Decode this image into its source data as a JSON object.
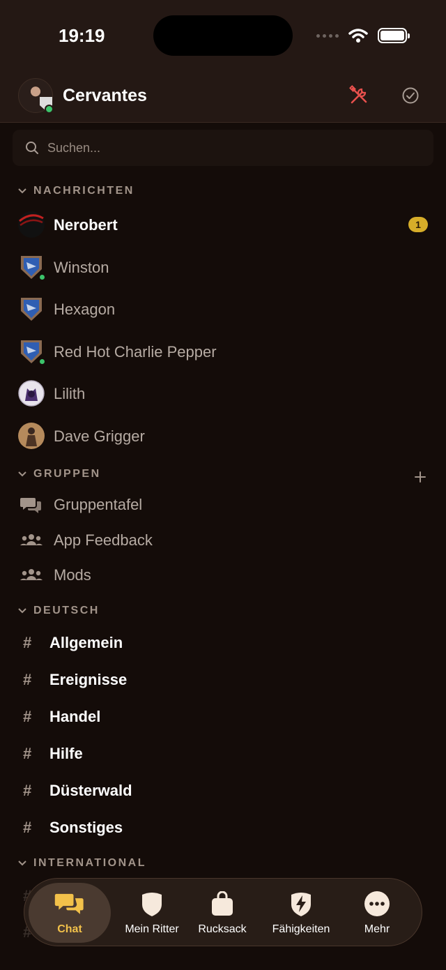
{
  "status_bar": {
    "time": "19:19"
  },
  "header": {
    "name": "Cervantes"
  },
  "search": {
    "placeholder": "Suchen..."
  },
  "sections": {
    "nachrichten": "NACHRICHTEN",
    "gruppen": "GRUPPEN",
    "deutsch": "DEUTSCH",
    "international": "INTERNATIONAL"
  },
  "direct_messages": [
    {
      "name": "Nerobert",
      "unread": "1"
    },
    {
      "name": "Winston"
    },
    {
      "name": "Hexagon"
    },
    {
      "name": "Red Hot Charlie Pepper"
    },
    {
      "name": "Lilith"
    },
    {
      "name": "Dave Grigger"
    }
  ],
  "groups": [
    {
      "name": "Gruppentafel",
      "icon": "chat-bubbles-icon"
    },
    {
      "name": "App Feedback",
      "icon": "people-icon"
    },
    {
      "name": "Mods",
      "icon": "people-icon"
    }
  ],
  "channels": [
    {
      "name": "Allgemein"
    },
    {
      "name": "Ereignisse"
    },
    {
      "name": "Handel"
    },
    {
      "name": "Hilfe"
    },
    {
      "name": "Düsterwald"
    },
    {
      "name": "Sonstiges"
    }
  ],
  "tabbar": [
    {
      "label": "Chat",
      "icon": "chat-icon",
      "active": true
    },
    {
      "label": "Mein Ritter",
      "icon": "shield-icon"
    },
    {
      "label": "Rucksack",
      "icon": "bag-icon"
    },
    {
      "label": "Fähigkeiten",
      "icon": "lightning-shield-icon"
    },
    {
      "label": "Mehr",
      "icon": "more-icon"
    }
  ],
  "colors": {
    "background": "#140c09",
    "header": "#241814",
    "accent": "#f2c14a",
    "badge": "#d6ad29",
    "online": "#3cc46b"
  }
}
